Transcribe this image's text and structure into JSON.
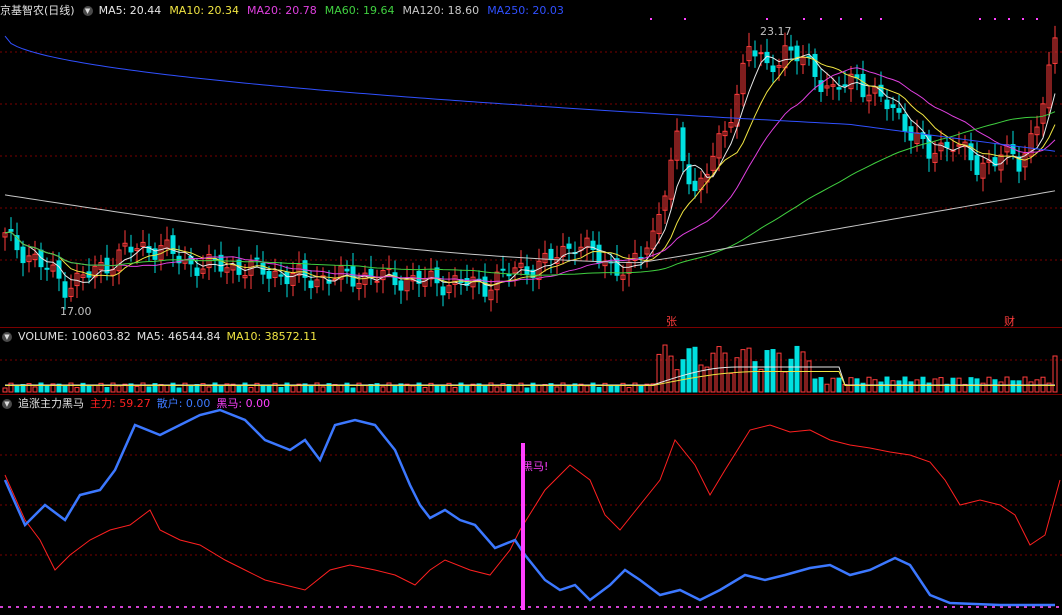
{
  "price_panel": {
    "title": "京基智农(日线)",
    "indicators": [
      {
        "label": "MA5: 20.44",
        "color": "#e8e8e8"
      },
      {
        "label": "MA10: 20.34",
        "color": "#f0e442"
      },
      {
        "label": "MA20: 20.78",
        "color": "#e040e0"
      },
      {
        "label": "MA60: 19.64",
        "color": "#40d040"
      },
      {
        "label": "MA120: 18.60",
        "color": "#c8c8c8"
      },
      {
        "label": "MA250: 20.03",
        "color": "#3050ff"
      }
    ],
    "high_label": "23.17",
    "low_label": "17.00",
    "marker_zhang": "张",
    "marker_cai": "财"
  },
  "volume_panel": {
    "title": "VOLUME: 100603.82",
    "ma5": "MA5: 46544.84",
    "ma10": "MA10: 38572.11"
  },
  "indicator_panel": {
    "title": "追涨主力黑马",
    "zhuli": "主力: 59.27",
    "sanhu": "散户: 0.00",
    "heima": "黑马: 0.00",
    "signal_label": "黑马!"
  },
  "colors": {
    "up": "#ff3c3c",
    "down": "#00e0e0",
    "grid": "#7a0000",
    "zhuli": "#ff2020",
    "sanhu": "#3c78ff",
    "heima": "#ff40ff"
  },
  "chart_data": [
    {
      "type": "candlestick",
      "title": "京基智农(日线)",
      "high": 23.17,
      "low": 17.0,
      "ma": {
        "MA5": 20.44,
        "MA10": 20.34,
        "MA20": 20.78,
        "MA60": 19.64,
        "MA120": 18.6,
        "MA250": 20.03
      }
    },
    {
      "type": "bar",
      "title": "VOLUME",
      "values_last": 100603.82,
      "MA5": 46544.84,
      "MA10": 38572.11
    },
    {
      "type": "line",
      "title": "追涨主力黑马",
      "series": [
        {
          "name": "主力",
          "last": 59.27
        },
        {
          "name": "散户",
          "last": 0.0
        },
        {
          "name": "黑马",
          "last": 0.0
        }
      ]
    }
  ]
}
